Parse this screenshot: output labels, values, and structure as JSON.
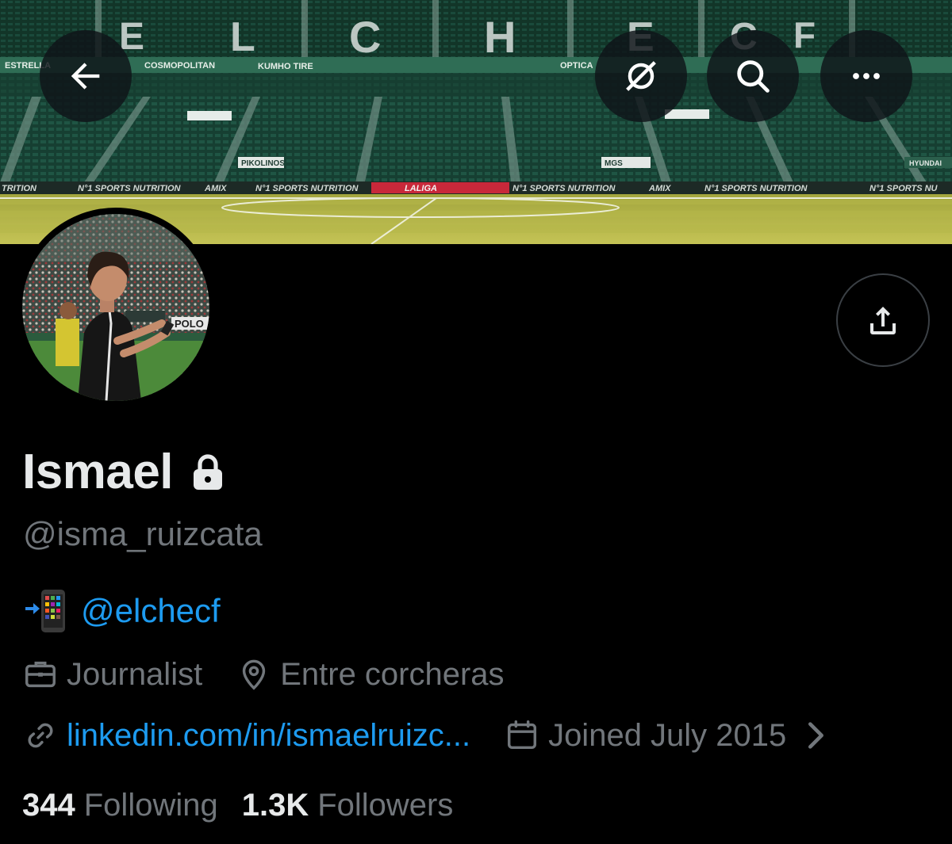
{
  "header": {
    "back_icon": "arrow-left-icon",
    "grok_icon": "grok-icon",
    "search_icon": "search-icon",
    "more_icon": "more-horizontal-icon"
  },
  "banner": {
    "stadium_letters": [
      "E",
      "L",
      "C",
      "H",
      "E",
      "C",
      "F"
    ],
    "ad_boards": [
      "ESTRELLA",
      "COSMOPOLITAN",
      "KUMHO TIRE",
      "OPTICA",
      "PIKOLINOS",
      "MGS",
      "HYUNDAI"
    ],
    "pitch_boards": [
      "TRITION",
      "N°1 SPORTS NUTRITION",
      "AMIX",
      "N°1 SPORTS NUTRITION",
      "LALIGA",
      "N°1 SPORTS NUTRITION",
      "AMIX",
      "N°1 SPORTS NUTRITION",
      "N°1 SPORTS NU"
    ]
  },
  "profile": {
    "display_name": "Ismael",
    "protected_icon": "lock-icon",
    "handle": "@isma_ruizcata",
    "bio_emoji": "📲",
    "bio_mention": "@elchecf",
    "profession": "Journalist",
    "location": "Entre corcheras",
    "website": "linkedin.com/in/ismaelruizc...",
    "joined": "Joined July 2015"
  },
  "stats": {
    "following_count": "344",
    "following_label": "Following",
    "followers_count": "1.3K",
    "followers_label": "Followers"
  },
  "colors": {
    "background": "#000000",
    "primary_text": "#e7e9ea",
    "secondary_text": "#71767b",
    "link": "#1d9bf0",
    "button_bg": "#0f1419"
  }
}
